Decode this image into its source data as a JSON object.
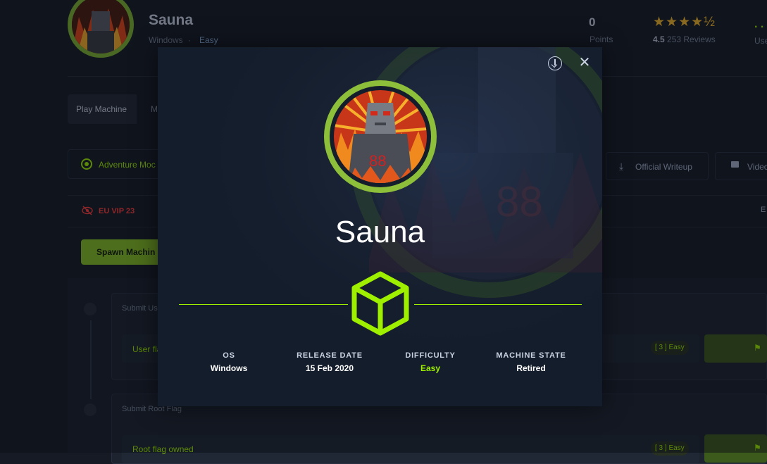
{
  "header": {
    "machine_name": "Sauna",
    "os": "Windows",
    "separator": "·",
    "difficulty": "Easy",
    "points_value": "0",
    "points_label": "Points",
    "stars": "★★★★½",
    "rating_score": "4.5",
    "rating_reviews": "253 Reviews",
    "users_partial": ". .",
    "users_label": "Use"
  },
  "tabs": {
    "play_machine": "Play Machine",
    "partial_tab": "M"
  },
  "toolbar": {
    "adventure_mode": "Adventure Moc",
    "official_writeup": "Official Writeup",
    "video": "Video",
    "download_icon": "download-icon",
    "video_icon": "video-icon"
  },
  "vpn": {
    "server": "EU VIP 23",
    "right_partial": "E",
    "icon": "eye-slash-icon"
  },
  "spawn_button": "Spawn Machin",
  "flags": {
    "submit_user": "Submit Us",
    "user_flag": "User fla",
    "user_badge": "[ 3 ] Easy",
    "submit_root": "Submit Root Flag",
    "root_flag": "Root flag owned",
    "root_badge": "[ 3 ] Easy"
  },
  "modal": {
    "title": "Sauna",
    "close_icon": "close-icon",
    "download_icon": "download-circle-icon",
    "os_label": "OS",
    "os_value": "Windows",
    "release_label": "RELEASE DATE",
    "release_value": "15 Feb 2020",
    "difficulty_label": "DIFFICULTY",
    "difficulty_value": "Easy",
    "state_label": "MACHINE STATE",
    "state_value": "Retired"
  },
  "colors": {
    "accent_green": "#9fef00",
    "avatar_ring": "#8ebf3a",
    "background": "#151a24",
    "modal_bg": "#141d2b",
    "vip_red": "#ff3e3e",
    "star_gold": "#f2b62b"
  }
}
